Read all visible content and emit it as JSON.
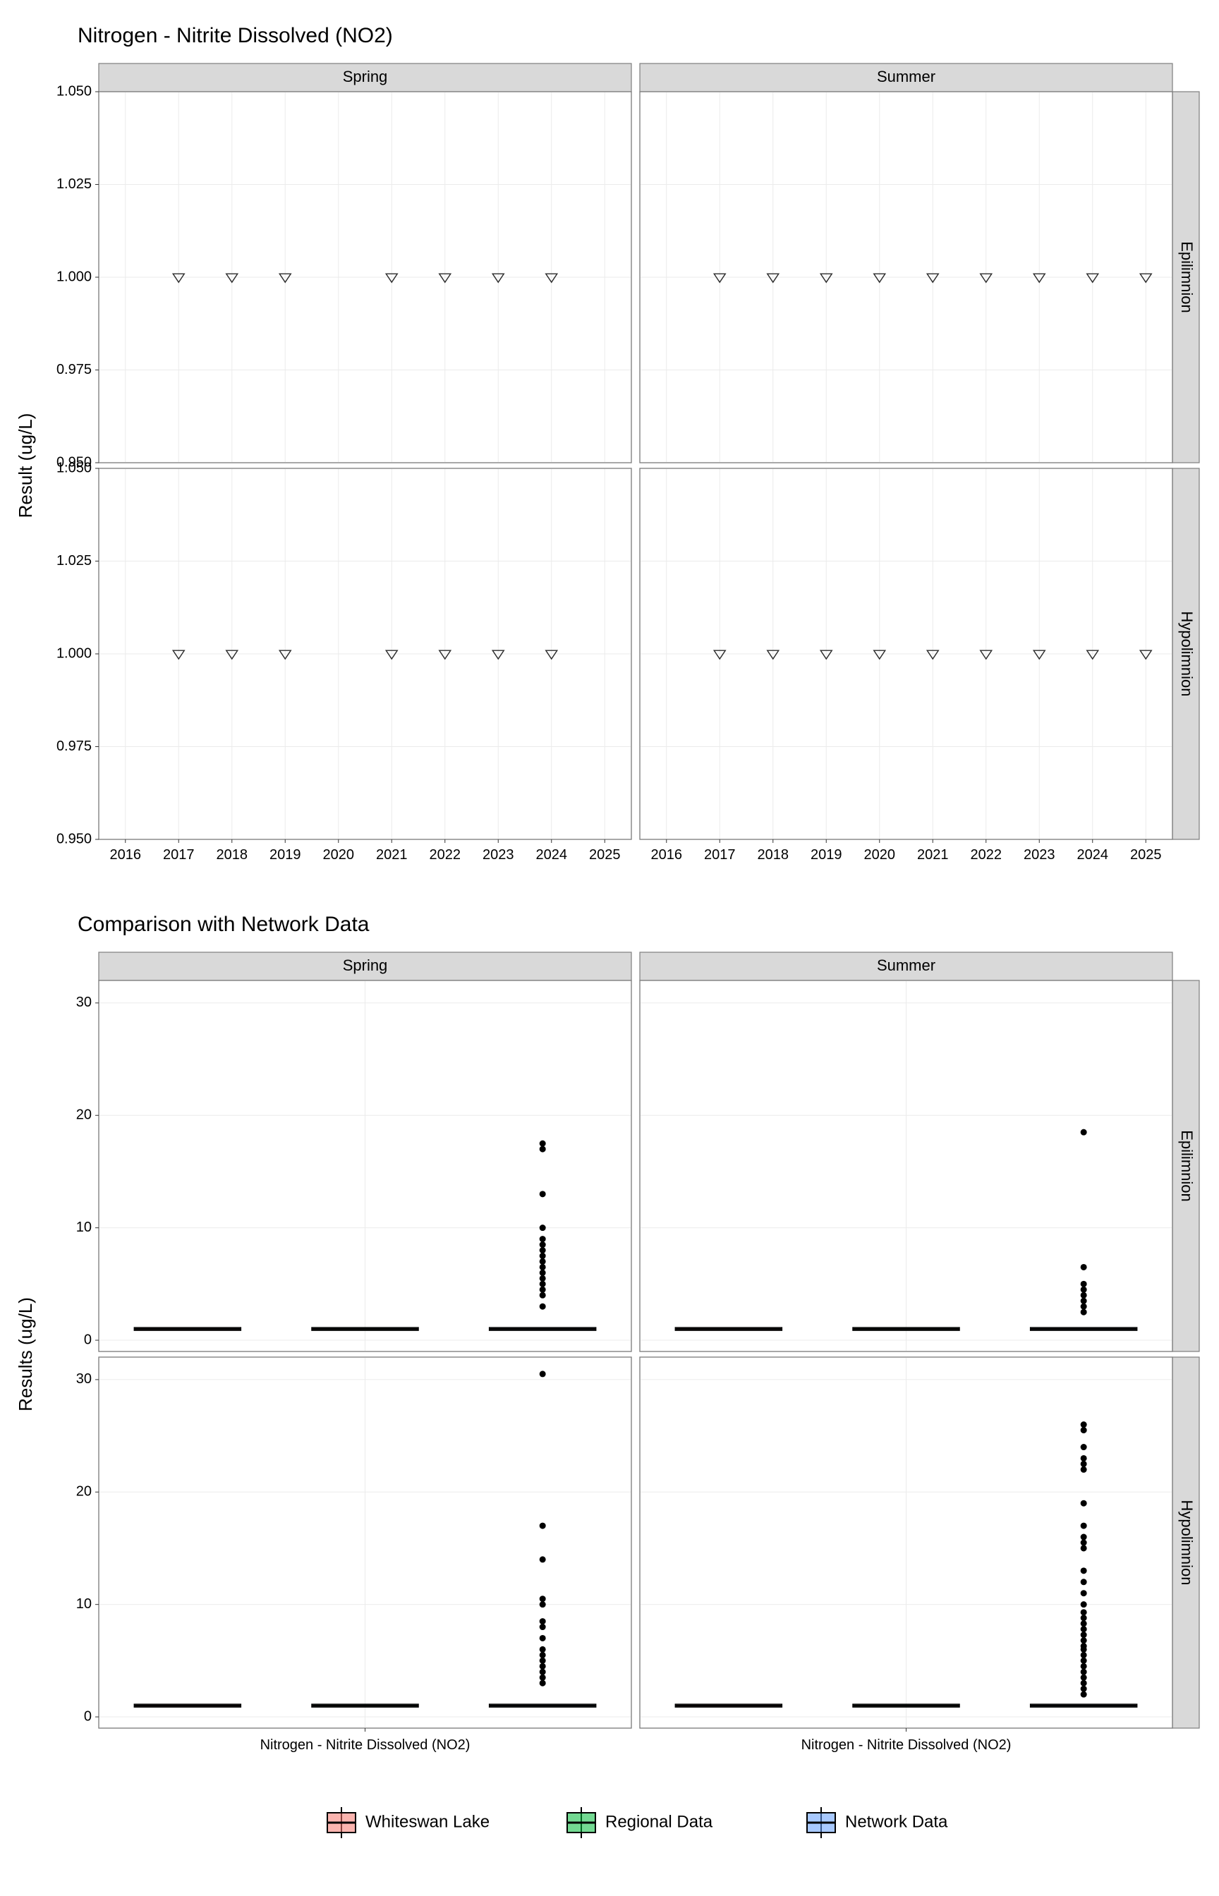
{
  "chart_data": [
    {
      "id": "timeseries",
      "type": "scatter",
      "title": "Nitrogen - Nitrite Dissolved (NO2)",
      "ylabel": "Result (ug/L)",
      "xlabel": "",
      "facet_cols": [
        "Spring",
        "Summer"
      ],
      "facet_rows": [
        "Epilimnion",
        "Hypolimnion"
      ],
      "x_ticks": [
        "2016",
        "2017",
        "2018",
        "2019",
        "2020",
        "2021",
        "2022",
        "2023",
        "2024",
        "2025"
      ],
      "y_ticks": [
        "0.950",
        "0.975",
        "1.000",
        "1.025",
        "1.050"
      ],
      "ylim": [
        0.95,
        1.05
      ],
      "xlim": [
        2015.5,
        2025.5
      ],
      "marker": "open-triangle-down",
      "series": [
        {
          "row": "Epilimnion",
          "col": "Spring",
          "x": [
            2017,
            2018,
            2019,
            2021,
            2022,
            2023,
            2024
          ],
          "y": [
            1,
            1,
            1,
            1,
            1,
            1,
            1
          ]
        },
        {
          "row": "Epilimnion",
          "col": "Summer",
          "x": [
            2017,
            2018,
            2019,
            2020,
            2021,
            2022,
            2023,
            2024,
            2025
          ],
          "y": [
            1,
            1,
            1,
            1,
            1,
            1,
            1,
            1,
            1
          ]
        },
        {
          "row": "Hypolimnion",
          "col": "Spring",
          "x": [
            2017,
            2018,
            2019,
            2021,
            2022,
            2023,
            2024
          ],
          "y": [
            1,
            1,
            1,
            1,
            1,
            1,
            1
          ]
        },
        {
          "row": "Hypolimnion",
          "col": "Summer",
          "x": [
            2017,
            2018,
            2019,
            2020,
            2021,
            2022,
            2023,
            2024,
            2025
          ],
          "y": [
            1,
            1,
            1,
            1,
            1,
            1,
            1,
            1,
            1
          ]
        }
      ]
    },
    {
      "id": "comparison",
      "type": "table",
      "title": "Comparison with Network Data",
      "ylabel": "Results (ug/L)",
      "xlabel": "Nitrogen - Nitrite Dissolved (NO2)",
      "facet_cols": [
        "Spring",
        "Summer"
      ],
      "facet_rows": [
        "Epilimnion",
        "Hypolimnion"
      ],
      "y_ticks": [
        "0",
        "10",
        "20",
        "30"
      ],
      "ylim": [
        -1,
        32
      ],
      "groups": [
        "Whiteswan Lake",
        "Regional Data",
        "Network Data"
      ],
      "box_median": 1.0,
      "outliers": [
        {
          "row": "Epilimnion",
          "col": "Spring",
          "group": "Network Data",
          "y": [
            3,
            4,
            4.5,
            5,
            5.5,
            6,
            6.5,
            7,
            7.5,
            8,
            8.5,
            9,
            10,
            13,
            17,
            17.5
          ]
        },
        {
          "row": "Epilimnion",
          "col": "Summer",
          "group": "Network Data",
          "y": [
            2.5,
            3,
            3.5,
            4,
            4.5,
            5,
            6.5,
            18.5
          ]
        },
        {
          "row": "Hypolimnion",
          "col": "Spring",
          "group": "Network Data",
          "y": [
            3,
            3.5,
            4,
            4.5,
            5,
            5.5,
            6,
            7,
            8,
            8.5,
            10,
            10.5,
            14,
            17,
            30.5
          ]
        },
        {
          "row": "Hypolimnion",
          "col": "Summer",
          "group": "Network Data",
          "y": [
            2,
            2.5,
            3,
            3.5,
            4,
            4.5,
            5,
            5.5,
            6,
            6.3,
            6.8,
            7.3,
            7.8,
            8.3,
            8.8,
            9.3,
            10,
            11,
            12,
            13,
            15,
            15.5,
            16,
            17,
            19,
            22,
            22.5,
            23,
            24,
            25.5,
            26
          ]
        }
      ]
    }
  ],
  "legend": {
    "items": [
      {
        "label": "Whiteswan Lake",
        "color": "#F8766D"
      },
      {
        "label": "Regional Data",
        "color": "#00BA38"
      },
      {
        "label": "Network Data",
        "color": "#619CFF"
      }
    ]
  }
}
